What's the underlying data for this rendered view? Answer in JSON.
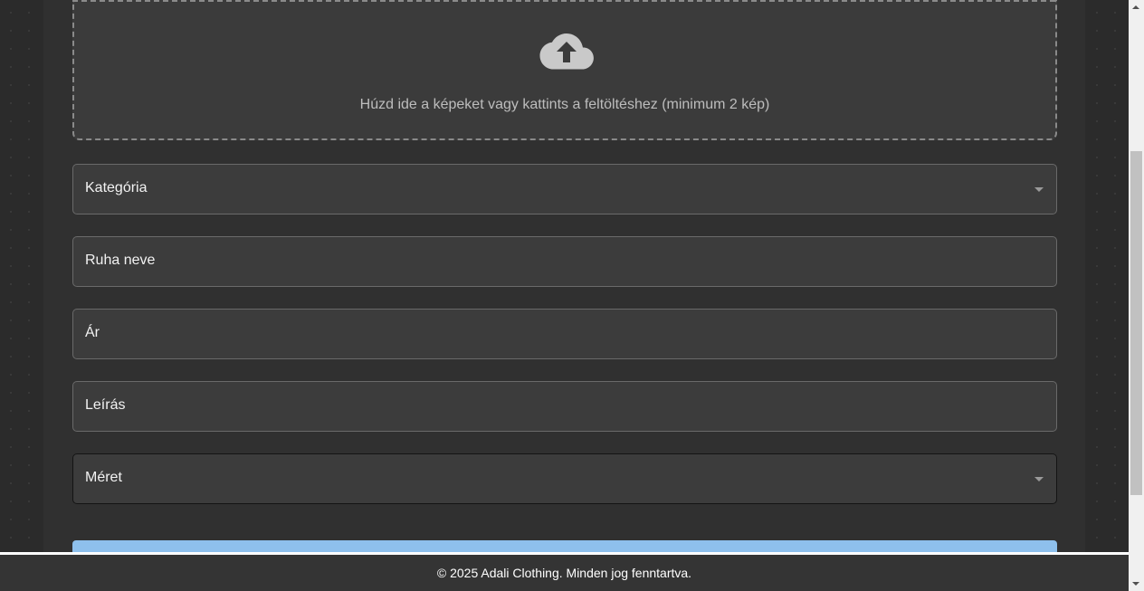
{
  "upload": {
    "instruction": "Húzd ide a képeket vagy kattints a feltöltéshez (minimum 2 kép)",
    "icon": "cloud-upload-icon"
  },
  "form": {
    "category_label": "Kategória",
    "name_label": "Ruha neve",
    "price_label": "Ár",
    "description_label": "Leírás",
    "size_label": "Méret"
  },
  "footer": {
    "text": "© 2025 Adali Clothing. Minden jog fenntartva."
  },
  "colors": {
    "background": "#2b2b2b",
    "panel": "#303030",
    "field": "#3c3c3c",
    "submit_button": "#8ec0ec",
    "footer": "#343434"
  }
}
